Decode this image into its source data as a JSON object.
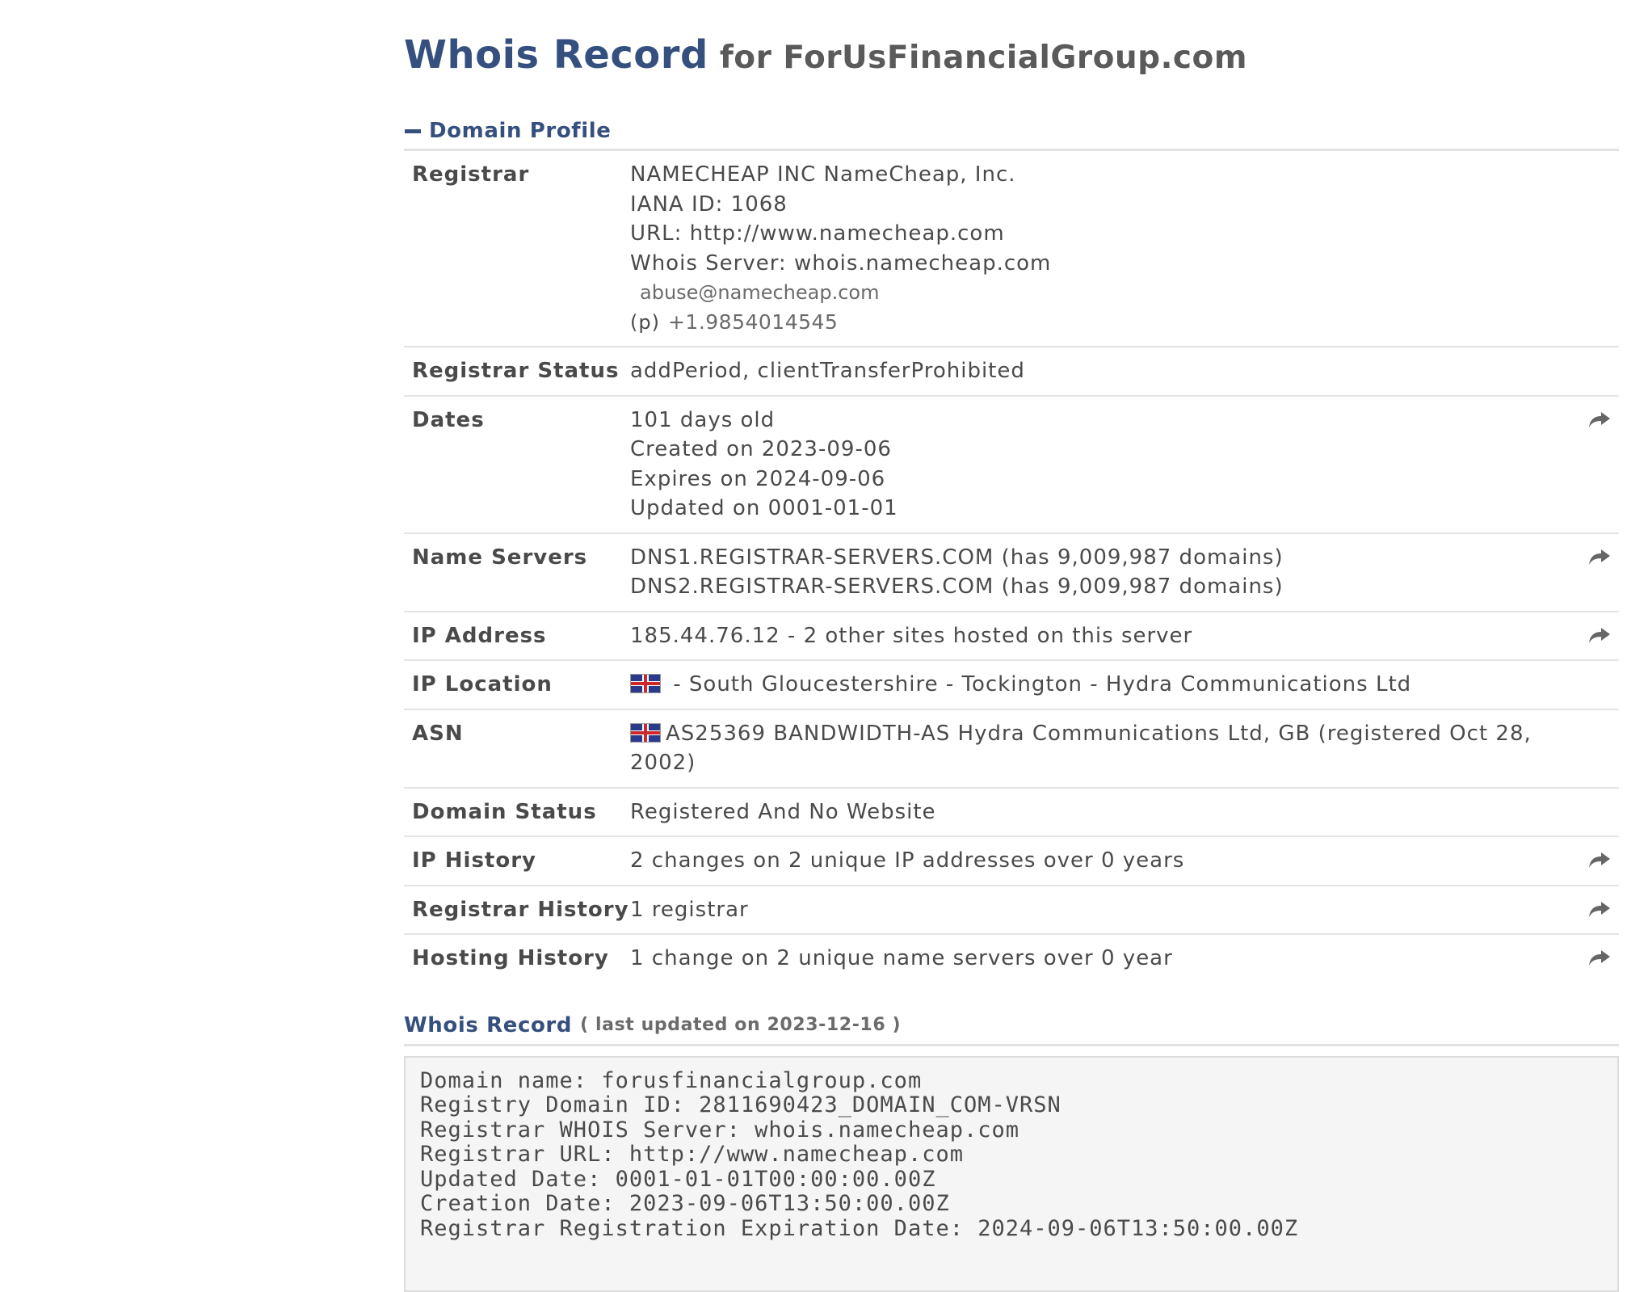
{
  "title": {
    "main": "Whois Record",
    "sub": "for ForUsFinancialGroup.com"
  },
  "profile_header": "Domain Profile",
  "rows": {
    "registrar": {
      "label": "Registrar",
      "lines": [
        "NAMECHEAP INC NameCheap, Inc.",
        "IANA ID: 1068",
        "URL: http://www.namecheap.com",
        "Whois Server: whois.namecheap.com"
      ],
      "abuse_email": "abuse@namecheap.com",
      "phone_prefix": "(p)",
      "phone": "+1.9854014545"
    },
    "registrar_status": {
      "label": "Registrar Status",
      "value": "addPeriod, clientTransferProhibited"
    },
    "dates": {
      "label": "Dates",
      "lines": [
        "101 days old",
        "Created on 2023-09-06",
        "Expires on 2024-09-06",
        "Updated on 0001-01-01"
      ]
    },
    "name_servers": {
      "label": "Name Servers",
      "lines": [
        "DNS1.REGISTRAR-SERVERS.COM (has 9,009,987 domains)",
        "DNS2.REGISTRAR-SERVERS.COM (has 9,009,987 domains)"
      ]
    },
    "ip_address": {
      "label": "IP Address",
      "value": "185.44.76.12 - 2 other sites hosted on this server"
    },
    "ip_location": {
      "label": "IP Location",
      "value": " - South Gloucestershire - Tockington - Hydra Communications Ltd"
    },
    "asn": {
      "label": "ASN",
      "value": "AS25369 BANDWIDTH-AS Hydra Communications Ltd, GB (registered Oct 28, 2002)"
    },
    "domain_status": {
      "label": "Domain Status",
      "value": "Registered And No Website"
    },
    "ip_history": {
      "label": "IP History",
      "value": "2 changes on 2 unique IP addresses over 0 years"
    },
    "registrar_history": {
      "label": "Registrar History",
      "value": "1 registrar"
    },
    "hosting_history": {
      "label": "Hosting History",
      "value": "1 change on 2 unique name servers over 0 year"
    }
  },
  "whois_record": {
    "header": "Whois Record",
    "sub": "( last updated on 2023-12-16 )",
    "raw": "Domain name: forusfinancialgroup.com\nRegistry Domain ID: 2811690423_DOMAIN_COM-VRSN\nRegistrar WHOIS Server: whois.namecheap.com\nRegistrar URL: http://www.namecheap.com\nUpdated Date: 0001-01-01T00:00:00.00Z\nCreation Date: 2023-09-06T13:50:00.00Z\nRegistrar Registration Expiration Date: 2024-09-06T13:50:00.00Z"
  },
  "icons": {
    "share": "share-arrow-icon",
    "collapse": "minus-icon",
    "flag": "uk-flag-icon"
  }
}
